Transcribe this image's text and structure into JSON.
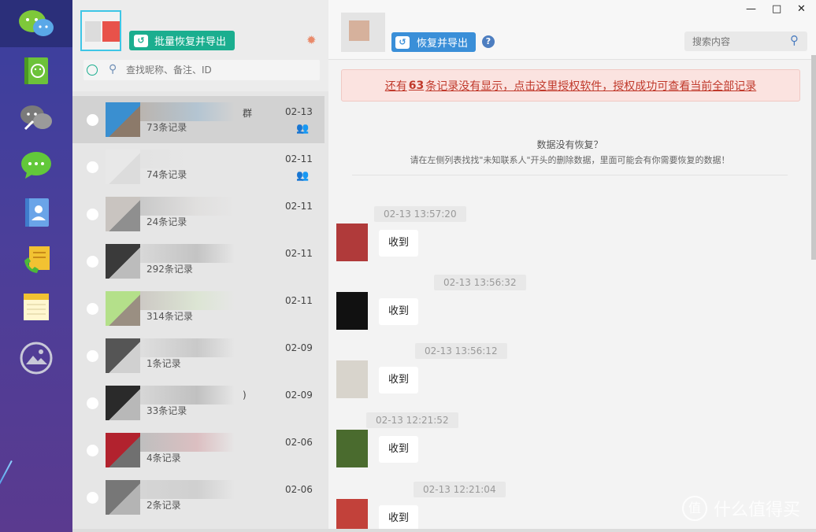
{
  "sidebar": {
    "nav": [
      {
        "icon": "wechat-logo-icon"
      },
      {
        "icon": "contacts-book-icon"
      },
      {
        "icon": "chat-link-icon"
      },
      {
        "icon": "chat-bubble-icon"
      },
      {
        "icon": "address-book-icon"
      },
      {
        "icon": "call-log-icon"
      },
      {
        "icon": "notes-icon"
      },
      {
        "icon": "photos-icon"
      }
    ]
  },
  "list_panel": {
    "batch_export_label": "批量恢复并导出",
    "search_placeholder": "查找昵称、备注、ID",
    "contacts": [
      {
        "count": "73条记录",
        "date": "02-13",
        "group": true,
        "selected": true,
        "name_suffix": "群",
        "colors": [
          "#3a8fd0",
          "#8c7a6a"
        ]
      },
      {
        "count": "74条记录",
        "date": "02-11",
        "group": true,
        "selected": false,
        "name_suffix": "",
        "colors": [
          "#e8e8e8",
          "#dcdcdc"
        ]
      },
      {
        "count": "24条记录",
        "date": "02-11",
        "group": false,
        "selected": false,
        "name_suffix": "",
        "colors": [
          "#c9c4c0",
          "#8f8f8f"
        ]
      },
      {
        "count": "292条记录",
        "date": "02-11",
        "group": false,
        "selected": false,
        "name_suffix": "",
        "colors": [
          "#3a3a3a",
          "#bcbcbc"
        ]
      },
      {
        "count": "314条记录",
        "date": "02-11",
        "group": false,
        "selected": false,
        "name_suffix": "",
        "colors": [
          "#b4e08a",
          "#9a8f82"
        ]
      },
      {
        "count": "1条记录",
        "date": "02-09",
        "group": false,
        "selected": false,
        "name_suffix": "",
        "colors": [
          "#555555",
          "#d0d0d0"
        ]
      },
      {
        "count": "33条记录",
        "date": "02-09",
        "group": false,
        "selected": false,
        "name_suffix": ")",
        "colors": [
          "#2a2a2a",
          "#b8b8b8"
        ]
      },
      {
        "count": "4条记录",
        "date": "02-06",
        "group": false,
        "selected": false,
        "name_suffix": "",
        "colors": [
          "#b2222e",
          "#707070"
        ]
      },
      {
        "count": "2条记录",
        "date": "02-06",
        "group": false,
        "selected": false,
        "name_suffix": "",
        "colors": [
          "#777777",
          "#b4b4b4"
        ]
      }
    ]
  },
  "main": {
    "restore_export_label": "恢复并导出",
    "help_label": "?",
    "search_placeholder": "搜索内容",
    "window_controls": {
      "minimize": "—",
      "maximize": "□",
      "close": "✕"
    },
    "notice": {
      "prefix": "还有",
      "count": "63",
      "suffix": "条记录没有显示，点击这里授权软件，授权成功可查看当前全部记录"
    },
    "tip_title": "数据没有恢复？",
    "tip_body": "请在左侧列表找找\"未知联系人\"开头的删除数据，里面可能会有你需要恢复的数据！",
    "messages": [
      {
        "time": "02-13 13:57:20",
        "text": "收到",
        "avatar_color": "#b03a3a"
      },
      {
        "time": "02-13 13:56:32",
        "text": "收到",
        "avatar_color": "#111111"
      },
      {
        "time": "02-13 13:56:12",
        "text": "收到",
        "avatar_color": "#d8d4cc"
      },
      {
        "time": "02-13 12:21:52",
        "text": "收到",
        "avatar_color": "#4a6b2e"
      },
      {
        "time": "02-13 12:21:04",
        "text": "收到",
        "avatar_color": "#c2413a"
      }
    ]
  },
  "watermark": {
    "text": "什么值得买",
    "logo": "值"
  },
  "colors": {
    "rail": "#3a3f9e",
    "green_button": "#1bae8f",
    "blue_button": "#3a8fd8",
    "notice_text": "#c0392b"
  }
}
